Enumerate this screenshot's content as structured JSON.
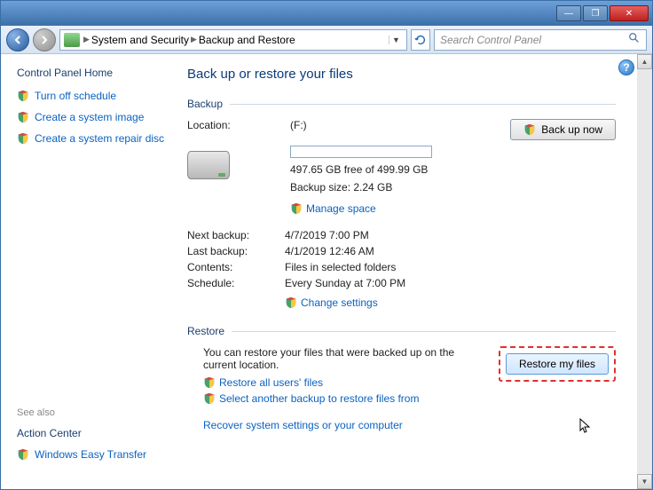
{
  "titlebar": {
    "min": "—",
    "max": "❐",
    "close": "✕"
  },
  "address": {
    "seg1": "System and Security",
    "seg2": "Backup and Restore"
  },
  "search": {
    "placeholder": "Search Control Panel"
  },
  "sidebar": {
    "home": "Control Panel Home",
    "links": [
      "Turn off schedule",
      "Create a system image",
      "Create a system repair disc"
    ],
    "seealso": "See also",
    "action_center": "Action Center",
    "wet": "Windows Easy Transfer"
  },
  "main": {
    "heading": "Back up or restore your files",
    "backup_label": "Backup",
    "location_label": "Location:",
    "location_value": "(F:)",
    "freespace": "497.65 GB free of 499.99 GB",
    "backup_size": "Backup size: 2.24 GB",
    "manage_space": "Manage space",
    "backup_now": "Back up now",
    "next_backup_label": "Next backup:",
    "next_backup_value": "4/7/2019 7:00 PM",
    "last_backup_label": "Last backup:",
    "last_backup_value": "4/1/2019 12:46 AM",
    "contents_label": "Contents:",
    "contents_value": "Files in selected folders",
    "schedule_label": "Schedule:",
    "schedule_value": "Every Sunday at 7:00 PM",
    "change_settings": "Change settings",
    "restore_label": "Restore",
    "restore_text": "You can restore your files that were backed up on the current location.",
    "restore_my_files": "Restore my files",
    "restore_all": "Restore all users' files",
    "select_another": "Select another backup to restore files from",
    "recover": "Recover system settings or your computer"
  }
}
